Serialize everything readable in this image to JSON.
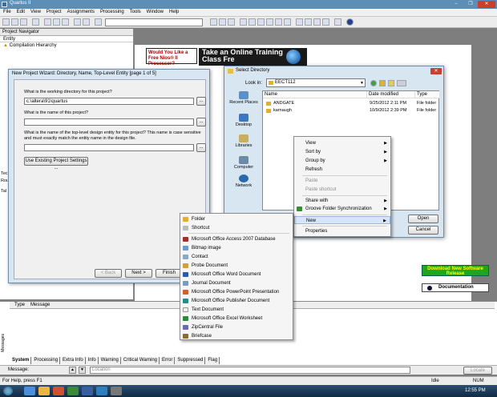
{
  "window": {
    "title": "Quartus II",
    "controls": [
      "–",
      "❐",
      "✕"
    ]
  },
  "menubar": [
    "File",
    "Edit",
    "View",
    "Project",
    "Assignments",
    "Processing",
    "Tools",
    "Window",
    "Help"
  ],
  "navigator": {
    "header": "Project Navigator",
    "column": "Entity",
    "item": "Compilation Hierarchy",
    "side_labels": [
      "Tec",
      "Rou",
      "Tal"
    ]
  },
  "ads": {
    "left": "Would You Like a Free Nios® II Processor?",
    "right": "Take an Online Training Class Fre",
    "download": "Download New Software Release",
    "docs": "Documentation"
  },
  "wizard": {
    "title": "New Project Wizard: Directory, Name, Top-Level Entity [page 1 of 5]",
    "q1": "What is the working directory for this project?",
    "dir_value": "c:\\altera\\91\\quartus",
    "q2": "What is the name of this project?",
    "q3": "What is the name of the top-level design entity for this project? This name is case sensitive and must exactly match the entity name in the design file.",
    "browse": "...",
    "use_existing": "Use Existing Project Settings ...",
    "back": "< Back",
    "next": "Next >",
    "finish": "Finish"
  },
  "select_dir": {
    "title": "Select Directory",
    "lookin_label": "Look in:",
    "lookin_value": "EECT112",
    "places": [
      "Recent Places",
      "Desktop",
      "Libraries",
      "Computer",
      "Network"
    ],
    "columns": [
      "Name",
      "Date modified",
      "Type"
    ],
    "files": [
      {
        "name": "ANDGATE",
        "date": "9/25/2012 2:11 PM",
        "type": "File folder"
      },
      {
        "name": "karnaugh",
        "date": "10/9/2012 2:39 PM",
        "type": "File folder"
      }
    ],
    "open": "Open",
    "cancel": "Cancel"
  },
  "context_menu": {
    "items": [
      "View",
      "Sort by",
      "Group by",
      "Refresh",
      "Paste",
      "Paste shortcut",
      "Share with",
      "Groove Folder Synchronization",
      "New",
      "Properties"
    ]
  },
  "new_submenu": {
    "items": [
      "Folder",
      "Shortcut",
      "Microsoft Office Access 2007 Database",
      "Bitmap image",
      "Contact",
      "Probe Document",
      "Microsoft Office Word Document",
      "Journal Document",
      "Microsoft Office PowerPoint Presentation",
      "Microsoft Office Publisher Document",
      "Text Document",
      "Microsoft Office Excel Worksheet",
      "ZipCentral File",
      "Briefcase"
    ]
  },
  "messages": {
    "col_type": "Type",
    "col_message": "Message",
    "tabs": [
      "System",
      "Processing",
      "Extra Info",
      "Info",
      "Warning",
      "Critical Warning",
      "Error",
      "Suppressed",
      "Flag"
    ],
    "label": "Message:",
    "location_placeholder": "Location",
    "locate": "Locate",
    "side": "Messages"
  },
  "status": {
    "help": "For Help, press F1",
    "idle": "Idle",
    "num": "NUM"
  },
  "taskbar": {
    "time": "12:55 PM"
  }
}
